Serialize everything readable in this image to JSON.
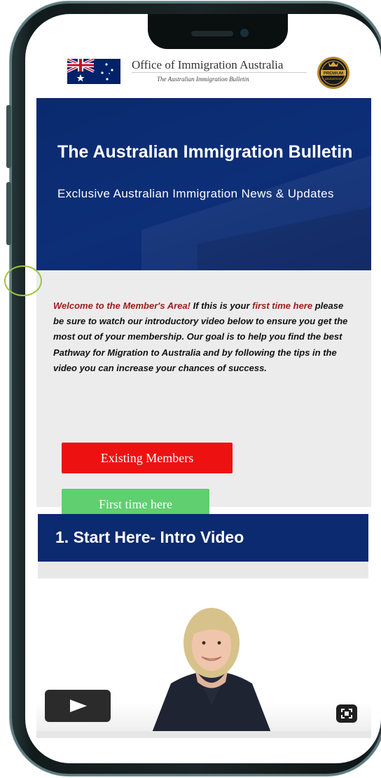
{
  "header": {
    "office_title": "Office of Immigration Australia",
    "office_subtitle": "The Australian Immigration Bulletin",
    "flag_icon": "australian-flag-icon",
    "badge_icon": "premium-membership-badge-icon",
    "badge_text": "PREMIUM",
    "badge_subtext": "MEMBERSHIP"
  },
  "hero": {
    "title": "The Australian Immigration Bulletin",
    "subtitle": "Exclusive Australian Immigration News & Updates",
    "background_color": "#0b2a6f"
  },
  "welcome": {
    "part1": "Welcome to the Member's Area!",
    "part2": " If this is your ",
    "part3": "first time here",
    "part4": " please be sure to watch our introductory video below to ensure you get the most out of your membership.  Our goal is to help you find the best Pathway for Migration to Australia and by following the tips in the video you can increase your chances of success."
  },
  "buttons": {
    "existing_label": "Existing Members",
    "existing_color": "#ee1111",
    "first_label": "First time here",
    "first_color": "#5fcf6f"
  },
  "section": {
    "title": "1. Start Here- Intro Video"
  },
  "video": {
    "play_icon": "play-icon",
    "fullscreen_icon": "fullscreen-icon"
  }
}
